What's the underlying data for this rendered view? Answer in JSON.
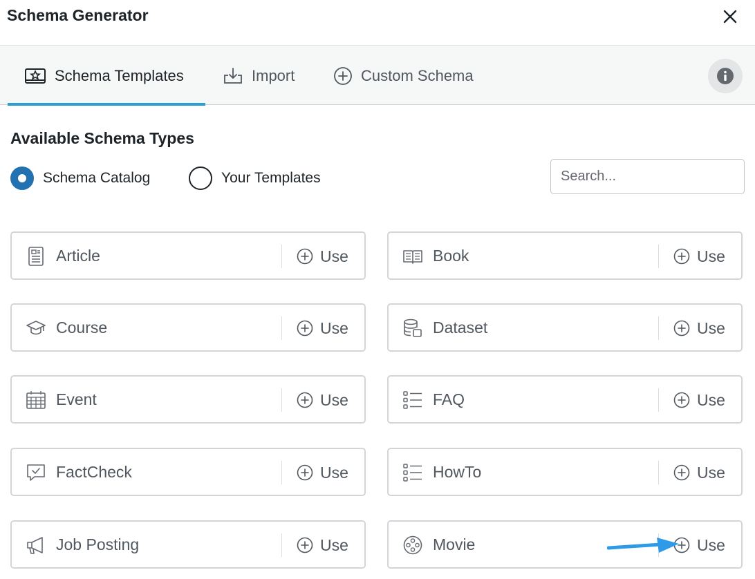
{
  "modal": {
    "title": "Schema Generator",
    "close_icon": "close-icon"
  },
  "tabs": [
    {
      "label": "Schema Templates",
      "icon": "template-icon",
      "active": true
    },
    {
      "label": "Import",
      "icon": "import-icon",
      "active": false
    },
    {
      "label": "Custom Schema",
      "icon": "plus-circle-icon",
      "active": false
    }
  ],
  "info_icon": "info-icon",
  "section": {
    "title": "Available Schema Types",
    "radios": [
      {
        "label": "Schema Catalog",
        "checked": true
      },
      {
        "label": "Your Templates",
        "checked": false
      }
    ],
    "search": {
      "placeholder": "Search...",
      "value": ""
    }
  },
  "cards": [
    {
      "name": "Article",
      "icon": "article-icon",
      "action": "Use"
    },
    {
      "name": "Book",
      "icon": "book-icon",
      "action": "Use"
    },
    {
      "name": "Course",
      "icon": "graduation-cap-icon",
      "action": "Use"
    },
    {
      "name": "Dataset",
      "icon": "database-icon",
      "action": "Use"
    },
    {
      "name": "Event",
      "icon": "calendar-icon",
      "action": "Use"
    },
    {
      "name": "FAQ",
      "icon": "list-icon",
      "action": "Use"
    },
    {
      "name": "FactCheck",
      "icon": "chat-check-icon",
      "action": "Use"
    },
    {
      "name": "HowTo",
      "icon": "list-icon",
      "action": "Use"
    },
    {
      "name": "Job Posting",
      "icon": "megaphone-icon",
      "action": "Use"
    },
    {
      "name": "Movie",
      "icon": "film-reel-icon",
      "action": "Use"
    }
  ],
  "annotation": {
    "icon": "arrow-right-icon",
    "color": "#2f9be8"
  },
  "colors": {
    "accent": "#2a9fd6",
    "radio_checked": "#2271b1"
  }
}
